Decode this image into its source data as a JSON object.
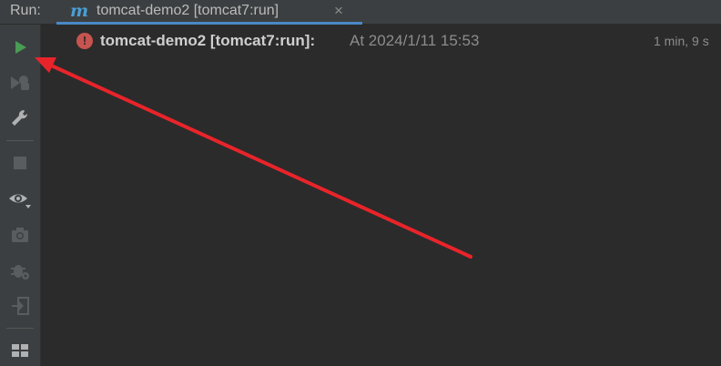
{
  "header": {
    "run_label": "Run:",
    "tab": {
      "icon": "maven-m-icon",
      "icon_glyph": "m",
      "label": "tomcat-demo2 [tomcat7:run]",
      "close_glyph": "×"
    }
  },
  "toolbar": {
    "buttons": [
      {
        "name": "rerun-icon",
        "interactable": true
      },
      {
        "name": "rerun-failed-icon",
        "interactable": true
      },
      {
        "name": "wrench-icon",
        "interactable": true
      },
      {
        "name": "stop-icon",
        "interactable": true
      },
      {
        "name": "eye-icon",
        "interactable": true
      },
      {
        "name": "camera-icon",
        "interactable": true
      },
      {
        "name": "bug-settings-icon",
        "interactable": true
      },
      {
        "name": "exit-icon",
        "interactable": true
      },
      {
        "name": "layout-icon",
        "interactable": true
      }
    ]
  },
  "run_tree": {
    "items": [
      {
        "status_icon": "error-icon",
        "status_glyph": "!",
        "title": "tomcat-demo2 [tomcat7:run]:",
        "time": "At 2024/1/11 15:53",
        "duration": "1 min, 9 s"
      }
    ]
  },
  "colors": {
    "accent": "#4a88c7",
    "error": "#c75450",
    "run_green": "#499c54",
    "annotation_arrow": "#e8242a"
  }
}
